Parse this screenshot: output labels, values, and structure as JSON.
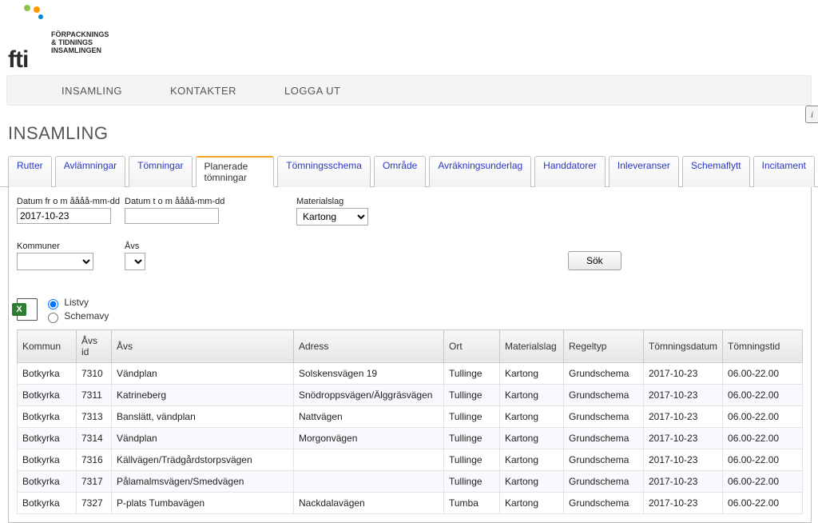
{
  "brand": {
    "name": "fti",
    "tagline1": "FÖRPACKNINGS",
    "tagline2": "& TIDNINGS",
    "tagline3": "INSAMLINGEN"
  },
  "topnav": {
    "insamling": "INSAMLING",
    "kontakter": "KONTAKTER",
    "loggaut": "LOGGA UT"
  },
  "page_title": "INSAMLING",
  "tabs": [
    {
      "id": "rutter",
      "label": "Rutter"
    },
    {
      "id": "avlamningar",
      "label": "Avlämningar"
    },
    {
      "id": "tomningar",
      "label": "Tömningar"
    },
    {
      "id": "planerade",
      "label": "Planerade tömningar"
    },
    {
      "id": "tomningsschema",
      "label": "Tömningsschema"
    },
    {
      "id": "omrade",
      "label": "Område"
    },
    {
      "id": "avrakning",
      "label": "Avräkningsunderlag"
    },
    {
      "id": "handdatorer",
      "label": "Handdatorer"
    },
    {
      "id": "inleveranser",
      "label": "Inleveranser"
    },
    {
      "id": "schemaflytt",
      "label": "Schemaflytt"
    },
    {
      "id": "incitament",
      "label": "Incitament"
    }
  ],
  "active_tab": "planerade",
  "filters": {
    "date_from_label": "Datum fr o m åååå-mm-dd",
    "date_from_value": "2017-10-23",
    "date_to_label": "Datum t o m åååå-mm-dd",
    "date_to_value": "",
    "material_label": "Materialslag",
    "material_value": "Kartong",
    "kommuner_label": "Kommuner",
    "kommuner_value": "",
    "avs_label": "Åvs",
    "avs_value": "",
    "search_label": "Sök"
  },
  "view": {
    "list": "Listvy",
    "schema": "Schemavy",
    "selected": "list"
  },
  "table": {
    "headers": {
      "kommun": "Kommun",
      "avsid": "Åvs id",
      "avs": "Åvs",
      "adress": "Adress",
      "ort": "Ort",
      "material": "Materialslag",
      "regeltyp": "Regeltyp",
      "datum": "Tömningsdatum",
      "tid": "Tömningstid"
    },
    "rows": [
      {
        "kommun": "Botkyrka",
        "avsid": "7310",
        "avs": "Vändplan",
        "adress": "Solskensvägen 19",
        "ort": "Tullinge",
        "material": "Kartong",
        "regeltyp": "Grundschema",
        "datum": "2017-10-23",
        "tid": "06.00-22.00"
      },
      {
        "kommun": "Botkyrka",
        "avsid": "7311",
        "avs": "Katrineberg",
        "adress": "Snödroppsvägen/Älggräsvägen",
        "ort": "Tullinge",
        "material": "Kartong",
        "regeltyp": "Grundschema",
        "datum": "2017-10-23",
        "tid": "06.00-22.00"
      },
      {
        "kommun": "Botkyrka",
        "avsid": "7313",
        "avs": "Banslätt, vändplan",
        "adress": "Nattvägen",
        "ort": "Tullinge",
        "material": "Kartong",
        "regeltyp": "Grundschema",
        "datum": "2017-10-23",
        "tid": "06.00-22.00"
      },
      {
        "kommun": "Botkyrka",
        "avsid": "7314",
        "avs": "Vändplan",
        "adress": "Morgonvägen",
        "ort": "Tullinge",
        "material": "Kartong",
        "regeltyp": "Grundschema",
        "datum": "2017-10-23",
        "tid": "06.00-22.00"
      },
      {
        "kommun": "Botkyrka",
        "avsid": "7316",
        "avs": "Källvägen/Trädgårdstorpsvägen",
        "adress": "",
        "ort": "Tullinge",
        "material": "Kartong",
        "regeltyp": "Grundschema",
        "datum": "2017-10-23",
        "tid": "06.00-22.00"
      },
      {
        "kommun": "Botkyrka",
        "avsid": "7317",
        "avs": "Pålamalmsvägen/Smedvägen",
        "adress": "",
        "ort": "Tullinge",
        "material": "Kartong",
        "regeltyp": "Grundschema",
        "datum": "2017-10-23",
        "tid": "06.00-22.00"
      },
      {
        "kommun": "Botkyrka",
        "avsid": "7327",
        "avs": "P-plats Tumbavägen",
        "adress": "Nackdalavägen",
        "ort": "Tumba",
        "material": "Kartong",
        "regeltyp": "Grundschema",
        "datum": "2017-10-23",
        "tid": "06.00-22.00"
      }
    ]
  },
  "info_icon_char": "i"
}
